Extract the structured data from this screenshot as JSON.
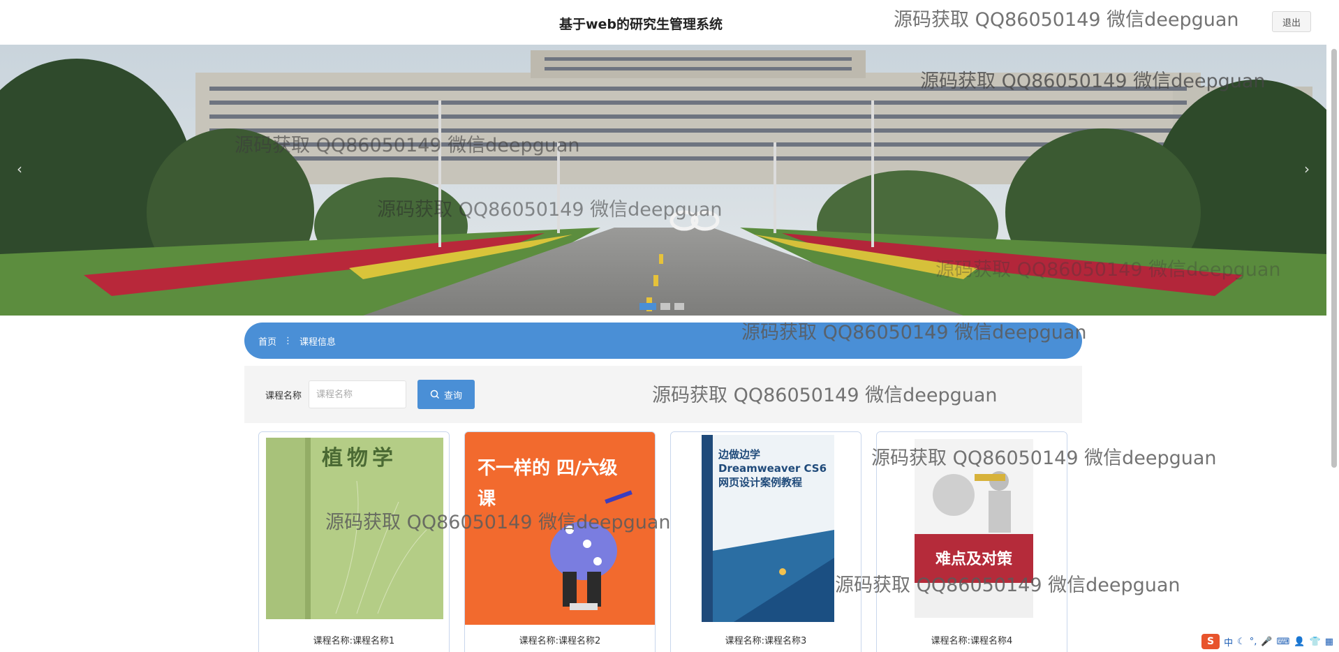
{
  "header": {
    "title": "基于web的研究生管理系统",
    "logout_label": "退出"
  },
  "banner": {
    "prev_arrow": "‹",
    "next_arrow": "›",
    "slide_count": 3,
    "active_slide": 1
  },
  "breadcrumb": {
    "home": "首页",
    "separator": "⋮",
    "current": "课程信息"
  },
  "search": {
    "label": "课程名称",
    "placeholder": "课程名称",
    "button_label": "查询"
  },
  "courses": [
    {
      "title": "课程名称:课程名称1",
      "cover_text": "植物学"
    },
    {
      "title": "课程名称:课程名称2",
      "cover_text": "不一样的 四/六级课"
    },
    {
      "title": "课程名称:课程名称3",
      "cover_text": "边做边学 Dreamweaver CS6 网页设计案例教程"
    },
    {
      "title": "课程名称:课程名称4",
      "cover_text": "难点及对策"
    }
  ],
  "watermark": "源码获取 QQ86050149 微信deepguan",
  "ime": {
    "lang": "中"
  },
  "colors": {
    "accent": "#4a8fd6",
    "ime_logo": "#e8542c"
  }
}
